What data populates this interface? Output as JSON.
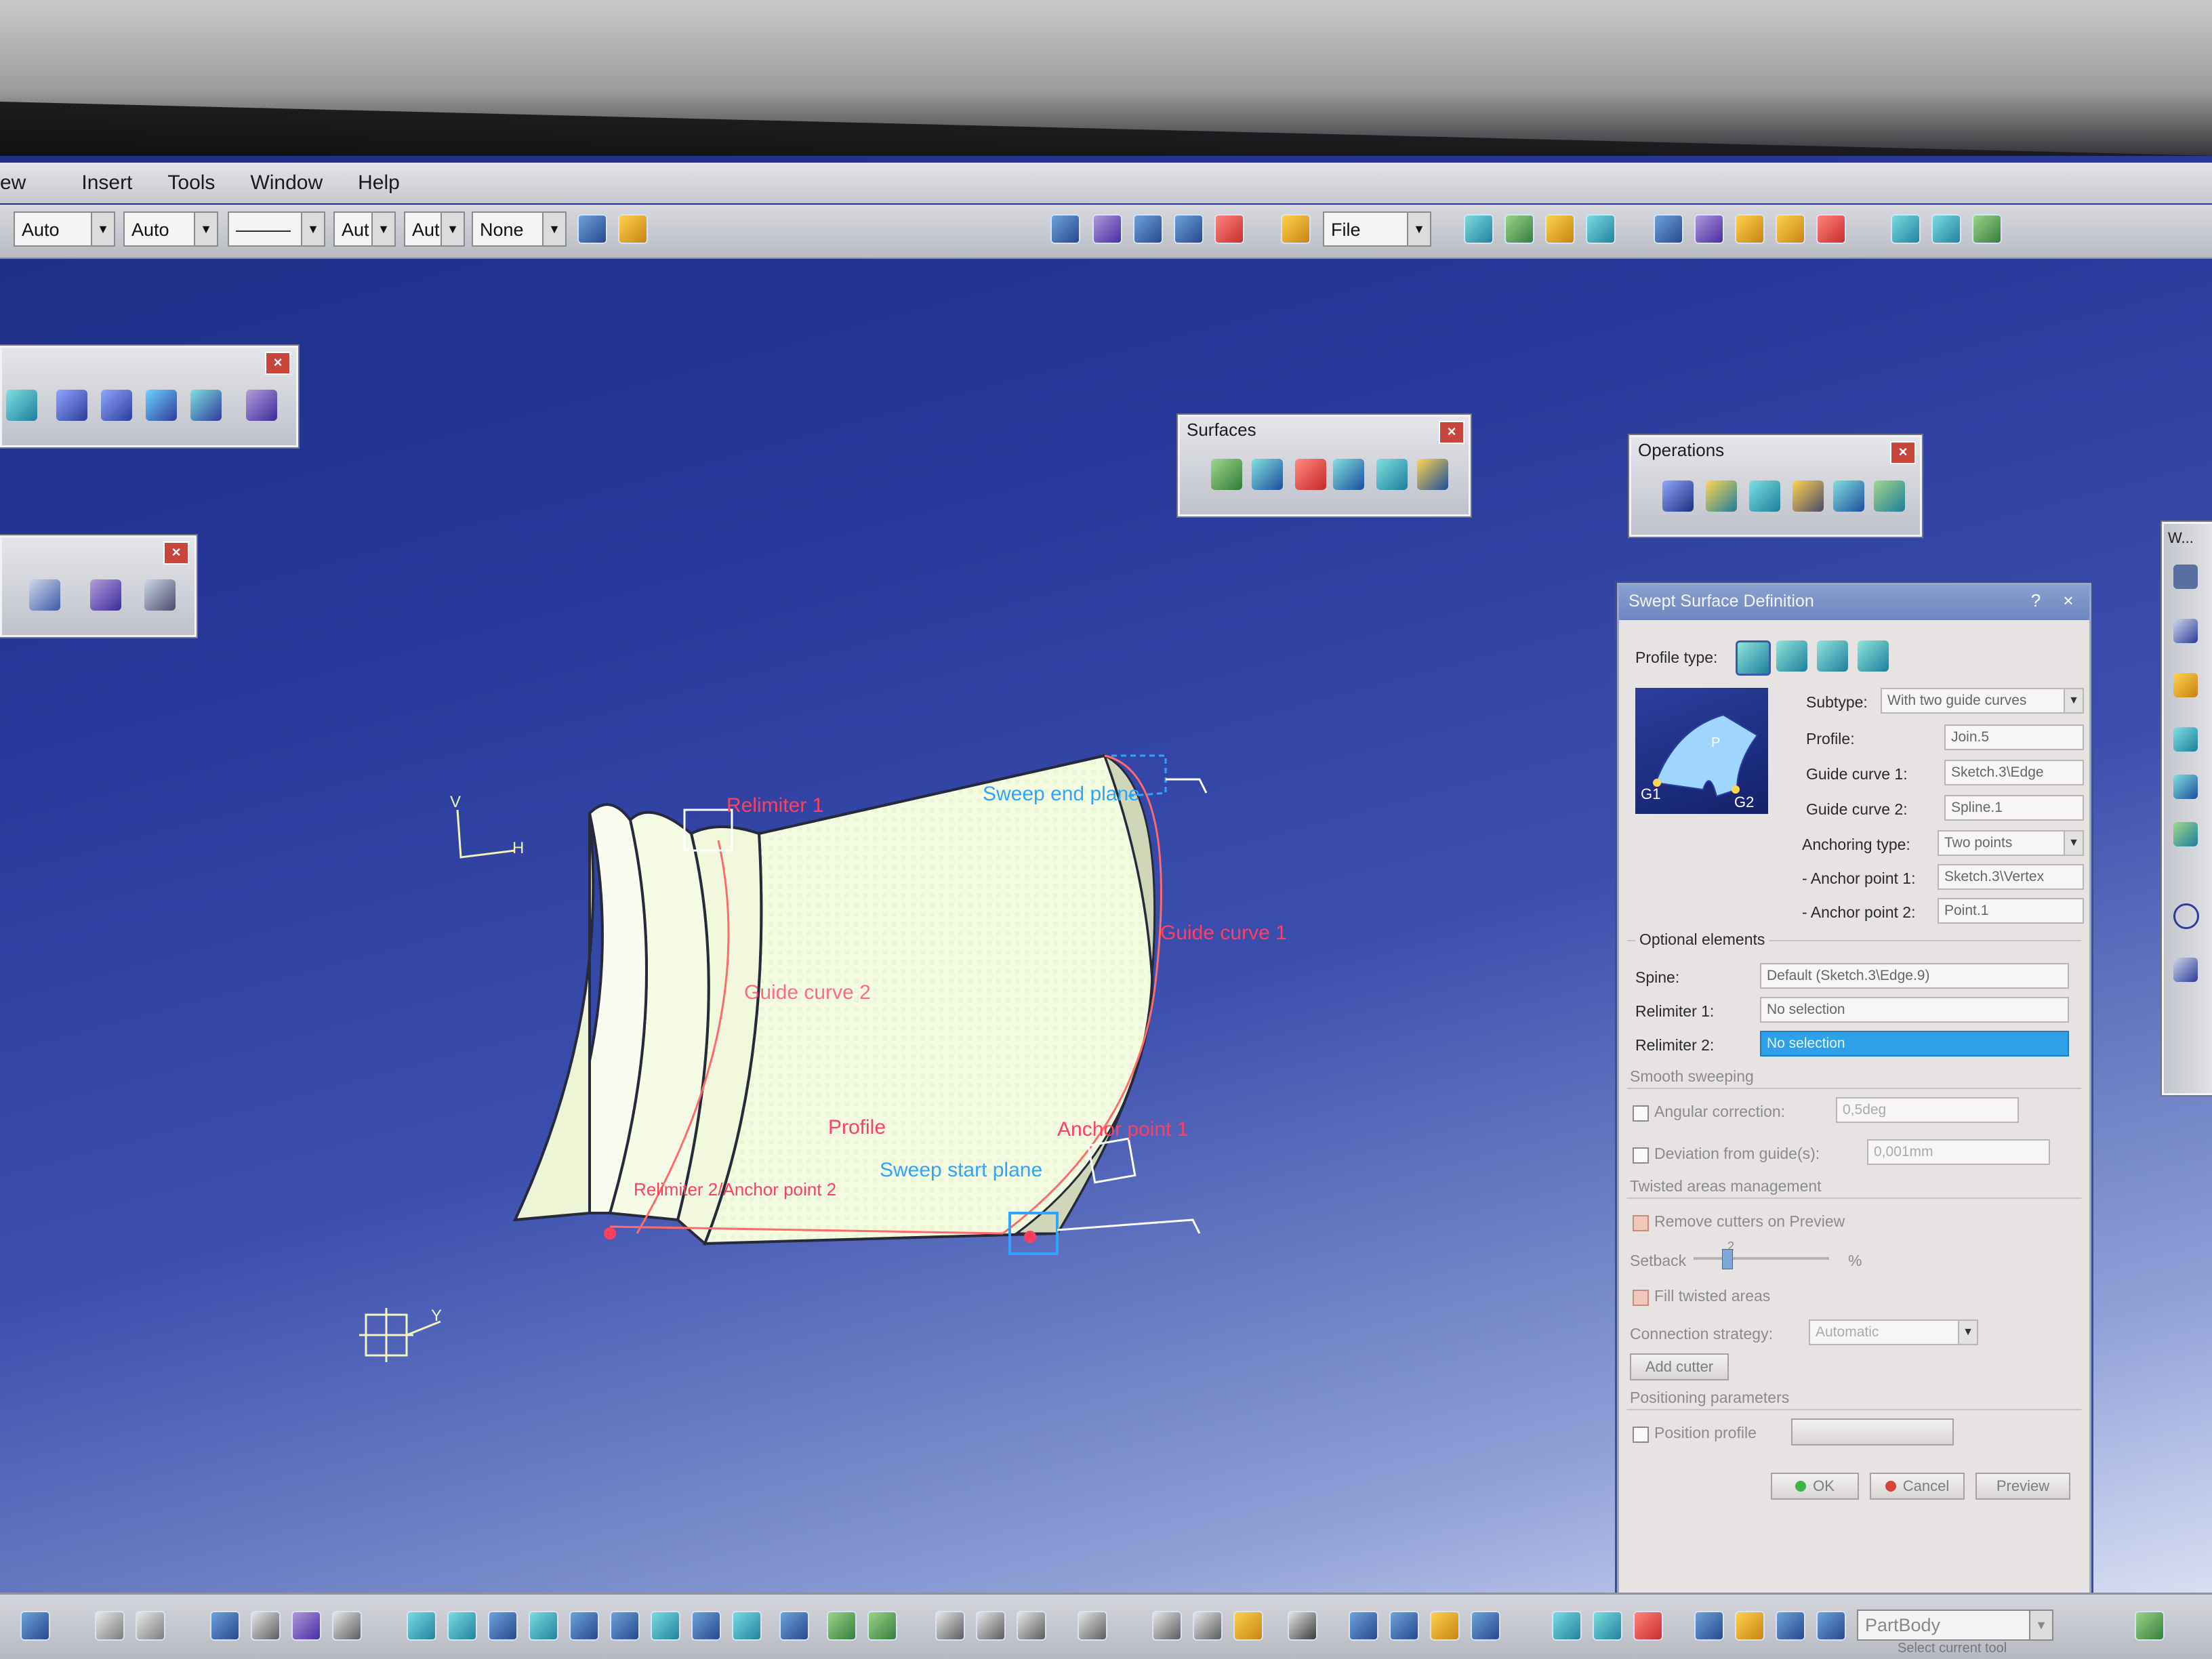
{
  "menu": [
    "ew",
    "Insert",
    "Tools",
    "Window",
    "Help"
  ],
  "toolbar": {
    "combos": [
      "Auto",
      "Auto",
      "———",
      "Aut",
      "Aut",
      "None"
    ],
    "file_combo": "File"
  },
  "panels": {
    "surfaces_title": "Surfaces",
    "operations_title": "Operations",
    "sidebar_title": "W..."
  },
  "geometry_labels": {
    "relimiter_1": "Relimiter 1",
    "sweep_end_plane": "Sweep end plane",
    "guide_curve_1": "Guide curve 1",
    "guide_curve_2": "Guide curve 2",
    "profile": "Profile",
    "anchor_point_1": "Anchor point 1",
    "anchor_point_2": "Relimiter 2/Anchor point 2",
    "sweep_start_plane": "Sweep start plane",
    "axis_h": "H",
    "axis_v": "V",
    "axis_y": "Y"
  },
  "dialog": {
    "title": "Swept Surface Definition",
    "help_btn": "?",
    "close_btn": "×",
    "profile_type_label": "Profile type:",
    "preview_g1": "G1",
    "preview_g2": "G2",
    "preview_p": "P",
    "subtype_label": "Subtype:",
    "subtype_value": "With two guide curves",
    "profile_label": "Profile:",
    "profile_value": "Join.5",
    "guide1_label": "Guide curve 1:",
    "guide1_value": "Sketch.3\\Edge",
    "guide2_label": "Guide curve 2:",
    "guide2_value": "Spline.1",
    "anchoring_label": "Anchoring type:",
    "anchoring_value": "Two points",
    "anchor1_label": "- Anchor point 1:",
    "anchor1_value": "Sketch.3\\Vertex",
    "anchor2_label": "- Anchor point 2:",
    "anchor2_value": "Point.1",
    "optional_label": "Optional elements",
    "spine_label": "Spine:",
    "spine_value": "Default (Sketch.3\\Edge.9)",
    "relim1_label": "Relimiter 1:",
    "relim1_value": "No selection",
    "relim2_label": "Relimiter 2:",
    "relim2_value": "No selection",
    "smooth_label": "Smooth sweeping",
    "angular_label": "Angular correction:",
    "angular_value": "0,5deg",
    "deviation_label": "Deviation from guide(s):",
    "deviation_value": "0,001mm",
    "twisted_label": "Twisted areas management",
    "remove_cutters_label": "Remove cutters on Preview",
    "setback_label": "Setback",
    "setback_value": "2",
    "setback_unit": "%",
    "fill_twisted_label": "Fill twisted areas",
    "connection_label": "Connection strategy:",
    "connection_value": "Automatic",
    "add_cutter": "Add cutter",
    "positioning_label": "Positioning parameters",
    "position_profile_label": "Position profile",
    "ok": "OK",
    "cancel": "Cancel",
    "preview": "Preview"
  },
  "status": {
    "partbody_value": "PartBody",
    "select_hint": "Select current tool"
  },
  "colors": {
    "viewport_top": "#1f2d86",
    "surface_fill": "#f4fbe0",
    "label_red": "#ff3f5f",
    "label_blue": "#2fa4ff",
    "selection_blue": "#2fa0e8"
  }
}
